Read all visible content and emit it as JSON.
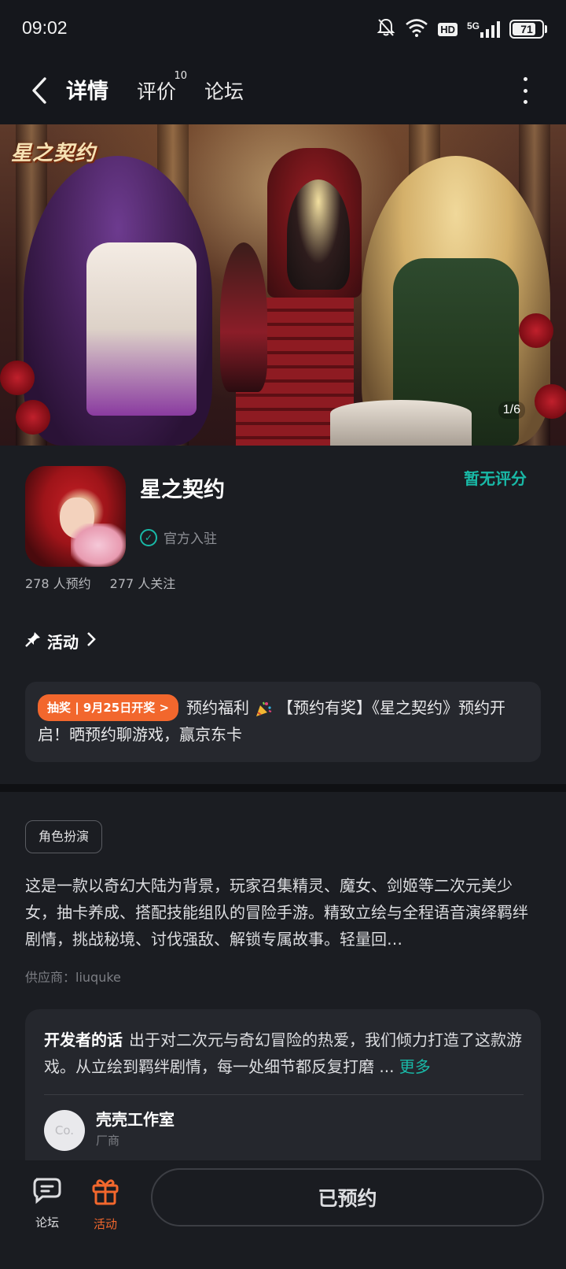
{
  "status_bar": {
    "time": "09:02",
    "hd": "HD",
    "network": "5G",
    "battery": "71",
    "icons": [
      "bell-off-icon",
      "wifi-icon",
      "hd-icon",
      "signal-icon",
      "battery-icon"
    ]
  },
  "nav": {
    "back_icon": "chevron-left-icon",
    "tabs": [
      {
        "label": "详情",
        "active": true
      },
      {
        "label": "评价",
        "count": "10"
      },
      {
        "label": "论坛"
      }
    ],
    "more_icon": "more-vertical-icon"
  },
  "banner": {
    "logo_text": "星之契约",
    "counter": "1/6"
  },
  "game": {
    "title": "星之契约",
    "official": "官方入驻",
    "rating": "暂无评分",
    "reservations": "278 人预约",
    "followers": "277 人关注"
  },
  "activity": {
    "header": "活动",
    "tag": "抽奖 | 9月25日开奖 >",
    "text_before": "预约福利",
    "text_after": "【预约有奖】《星之契约》预约开启！晒预约聊游戏，赢京东卡"
  },
  "details": {
    "genre": "角色扮演",
    "description": "这是一款以奇幻大陆为背景，玩家召集精灵、魔女、剑姬等二次元美少女，抽卡养成、搭配技能组队的冒险手游。精致立绘与全程语音演绎羁绊剧情，挑战秘境、讨伐强敌、解锁专属故事。轻量回…",
    "supplier": "供应商：liuquke"
  },
  "developer": {
    "label": "开发者的话",
    "text": "出于对二次元与奇幻冒险的热爱，我们倾力打造了这款游戏。从立绘到羁绊剧情，每一处细节都反复打磨 ...",
    "more": "更多",
    "avatar_text": "Co.",
    "name": "壳壳工作室",
    "role": "厂商"
  },
  "bottom": {
    "forum_label": "论坛",
    "activity_label": "活动",
    "reserve_label": "已预约"
  },
  "colors": {
    "accent": "#19b9a7",
    "orange": "#f2672d",
    "background": "#15171c"
  }
}
